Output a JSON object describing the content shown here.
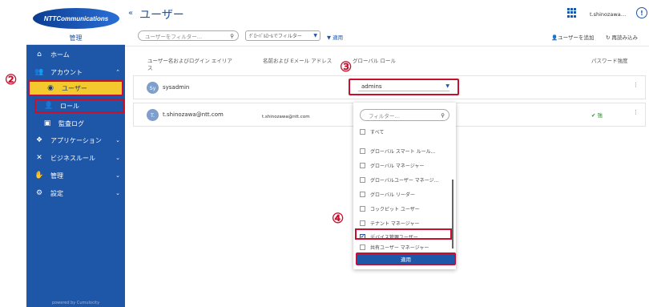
{
  "sidebar": {
    "logo_text": "NTTCommunications",
    "section_title": "管理",
    "items": [
      {
        "label": "ホーム",
        "icon": "home-icon"
      },
      {
        "label": "アカウント",
        "icon": "users-icon"
      },
      {
        "label": "ユーザー",
        "icon": "user-circle-icon"
      },
      {
        "label": "ロール",
        "icon": "role-icon"
      },
      {
        "label": "監査ログ",
        "icon": "audit-log-icon"
      },
      {
        "label": "アプリケーション",
        "icon": "apps-icon"
      },
      {
        "label": "ビジネスルール",
        "icon": "business-rules-icon"
      },
      {
        "label": "管理",
        "icon": "handshake-icon"
      },
      {
        "label": "設定",
        "icon": "gear-icon"
      }
    ],
    "powered_by": "powered by Cumulocity"
  },
  "annotations": {
    "c2": "②",
    "c3": "③",
    "c4": "④"
  },
  "header": {
    "back_glyph": "«",
    "title": "ユーザー",
    "username": "t.shinozawa…"
  },
  "toolbar": {
    "user_filter_placeholder": "ユーザーをフィルター…",
    "global_role_filter": "ｸﾞﾛｰﾊﾞﾙﾛｰﾙでフィルター",
    "apply": "適用",
    "add_user": "ユーザーを追加",
    "reload": "再読み込み"
  },
  "table": {
    "headers": {
      "name": "ユーザー名およびログイン エイリアス",
      "email": "名前および Eメール アドレス",
      "role": "グローバル ロール",
      "password": "パスワード強度"
    },
    "rows": [
      {
        "avatar": "Sy",
        "username": "sysadmin",
        "email": "",
        "role": "admins",
        "strength": ""
      },
      {
        "avatar": "T.",
        "username": "t.shinozawa@ntt.com",
        "email": "t.shinozawa@ntt.com",
        "role": "",
        "strength": "✔ 強"
      }
    ]
  },
  "dropdown": {
    "filter_placeholder": "フィルター…",
    "options": [
      {
        "label": "すべて",
        "checked": false
      },
      {
        "label": "グローバル スマート ルール…",
        "checked": false
      },
      {
        "label": "グローバル マネージャー",
        "checked": false
      },
      {
        "label": "グローバルユーザー マネージ…",
        "checked": false
      },
      {
        "label": "グローバル リーダー",
        "checked": false
      },
      {
        "label": "コックピット ユーザー",
        "checked": false
      },
      {
        "label": "テナント マネージャー",
        "checked": false
      },
      {
        "label": "デバイス管理ユーザー",
        "checked": true
      },
      {
        "label": "共有ユーザー マネージャー",
        "checked": false
      }
    ],
    "apply_button": "適用"
  }
}
